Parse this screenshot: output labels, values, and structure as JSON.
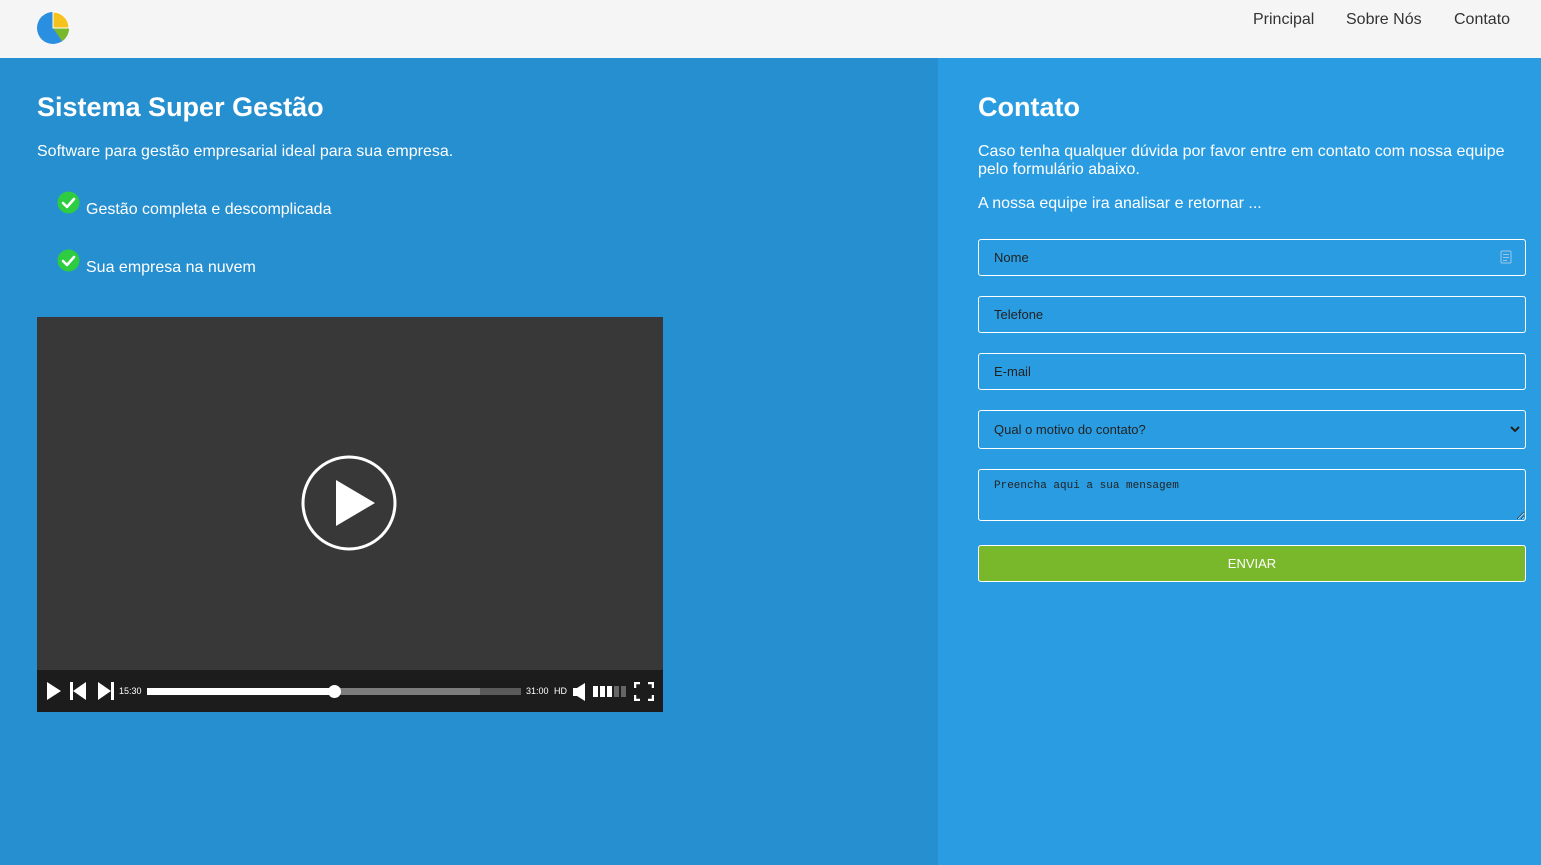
{
  "nav": {
    "links": [
      "Principal",
      "Sobre Nós",
      "Contato"
    ]
  },
  "left": {
    "title": "Sistema Super Gestão",
    "subtitle": "Software para gestão empresarial ideal para sua empresa.",
    "features": [
      "Gestão completa e descomplicada",
      "Sua empresa na nuvem"
    ]
  },
  "video": {
    "current_time": "15:30",
    "duration": "31:00",
    "quality": "HD",
    "progress": 0.5,
    "buffered": 0.89,
    "volume_level": 0.6
  },
  "contact": {
    "title": "Contato",
    "description": "Caso tenha qualquer dúvida por favor entre em contato com nossa equipe pelo formulário abaixo.",
    "description2": "A nossa equipe ira analisar e retornar ...",
    "fields": {
      "name_placeholder": "Nome",
      "phone_placeholder": "Telefone",
      "email_placeholder": "E-mail",
      "reason_selected": "Qual o motivo do contato?",
      "message_placeholder": "Preencha aqui a sua mensagem"
    },
    "submit_label": "ENVIAR"
  },
  "colors": {
    "header_bg": "#f5f5f5",
    "left_bg": "#268fd0",
    "right_bg": "#2a9de2",
    "check_green": "#2ecc40",
    "button_green": "#7ab82b",
    "video_bg": "#383838"
  }
}
